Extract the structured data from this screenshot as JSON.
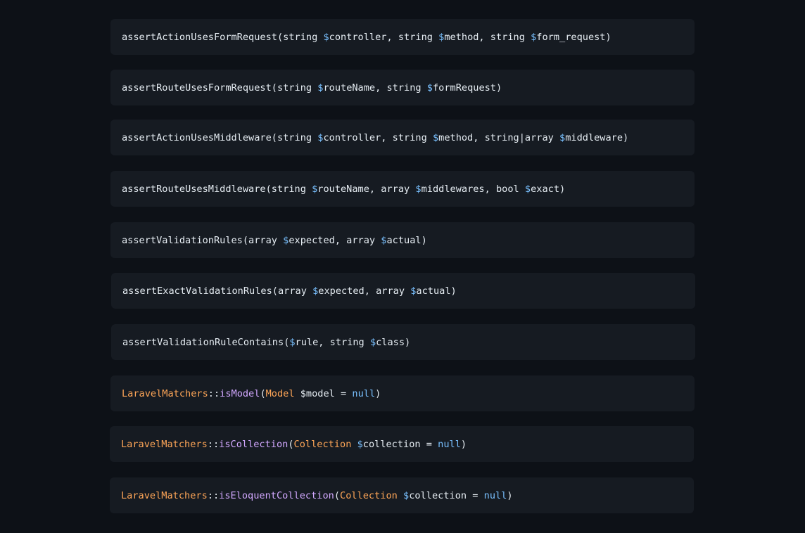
{
  "colors": {
    "background": "#0d1117",
    "block": "#161b22",
    "text": "#e6edf3",
    "variable": "#79c0ff",
    "class": "#ffa657",
    "function": "#d2a8ff",
    "constant": "#79c0ff"
  },
  "signatures": [
    {
      "tokens": [
        {
          "t": "plain",
          "v": "assertActionUsesFormRequest(string "
        },
        {
          "t": "var",
          "v": "$"
        },
        {
          "t": "plain",
          "v": "controller, string "
        },
        {
          "t": "var",
          "v": "$"
        },
        {
          "t": "plain",
          "v": "method, string "
        },
        {
          "t": "var",
          "v": "$"
        },
        {
          "t": "plain",
          "v": "form_request)"
        }
      ]
    },
    {
      "tokens": [
        {
          "t": "plain",
          "v": "assertRouteUsesFormRequest(string "
        },
        {
          "t": "var",
          "v": "$"
        },
        {
          "t": "plain",
          "v": "routeName, string "
        },
        {
          "t": "var",
          "v": "$"
        },
        {
          "t": "plain",
          "v": "formRequest)"
        }
      ]
    },
    {
      "tokens": [
        {
          "t": "plain",
          "v": "assertActionUsesMiddleware(string "
        },
        {
          "t": "var",
          "v": "$"
        },
        {
          "t": "plain",
          "v": "controller, string "
        },
        {
          "t": "var",
          "v": "$"
        },
        {
          "t": "plain",
          "v": "method, string|array "
        },
        {
          "t": "var",
          "v": "$"
        },
        {
          "t": "plain",
          "v": "middleware)"
        }
      ]
    },
    {
      "tokens": [
        {
          "t": "plain",
          "v": "assertRouteUsesMiddleware(string "
        },
        {
          "t": "var",
          "v": "$"
        },
        {
          "t": "plain",
          "v": "routeName, array "
        },
        {
          "t": "var",
          "v": "$"
        },
        {
          "t": "plain",
          "v": "middlewares, bool "
        },
        {
          "t": "var",
          "v": "$"
        },
        {
          "t": "plain",
          "v": "exact)"
        }
      ]
    },
    {
      "tokens": [
        {
          "t": "plain",
          "v": "assertValidationRules(array "
        },
        {
          "t": "var",
          "v": "$"
        },
        {
          "t": "plain",
          "v": "expected, array "
        },
        {
          "t": "var",
          "v": "$"
        },
        {
          "t": "plain",
          "v": "actual)"
        }
      ]
    },
    {
      "tokens": [
        {
          "t": "plain",
          "v": "assertExactValidationRules(array "
        },
        {
          "t": "var",
          "v": "$"
        },
        {
          "t": "plain",
          "v": "expected, array "
        },
        {
          "t": "var",
          "v": "$"
        },
        {
          "t": "plain",
          "v": "actual)"
        }
      ]
    },
    {
      "tokens": [
        {
          "t": "plain",
          "v": "assertValidationRuleContains("
        },
        {
          "t": "var",
          "v": "$"
        },
        {
          "t": "plain",
          "v": "rule, string "
        },
        {
          "t": "var",
          "v": "$"
        },
        {
          "t": "plain",
          "v": "class)"
        }
      ]
    },
    {
      "tokens": [
        {
          "t": "class",
          "v": "LaravelMatchers"
        },
        {
          "t": "op",
          "v": "::"
        },
        {
          "t": "func",
          "v": "isModel"
        },
        {
          "t": "plain",
          "v": "("
        },
        {
          "t": "class",
          "v": "Model"
        },
        {
          "t": "plain",
          "v": " $model = "
        },
        {
          "t": "const",
          "v": "null"
        },
        {
          "t": "plain",
          "v": ")"
        }
      ]
    },
    {
      "tokens": [
        {
          "t": "class",
          "v": "LaravelMatchers"
        },
        {
          "t": "op",
          "v": "::"
        },
        {
          "t": "func",
          "v": "isCollection"
        },
        {
          "t": "plain",
          "v": "("
        },
        {
          "t": "class",
          "v": "Collection"
        },
        {
          "t": "plain",
          "v": " "
        },
        {
          "t": "var",
          "v": "$"
        },
        {
          "t": "plain",
          "v": "collection = "
        },
        {
          "t": "const",
          "v": "null"
        },
        {
          "t": "plain",
          "v": ")"
        }
      ]
    },
    {
      "tokens": [
        {
          "t": "class",
          "v": "LaravelMatchers"
        },
        {
          "t": "op",
          "v": "::"
        },
        {
          "t": "func",
          "v": "isEloquentCollection"
        },
        {
          "t": "plain",
          "v": "("
        },
        {
          "t": "class",
          "v": "Collection"
        },
        {
          "t": "plain",
          "v": " "
        },
        {
          "t": "var",
          "v": "$"
        },
        {
          "t": "plain",
          "v": "collection = "
        },
        {
          "t": "const",
          "v": "null"
        },
        {
          "t": "plain",
          "v": ")"
        }
      ]
    }
  ]
}
